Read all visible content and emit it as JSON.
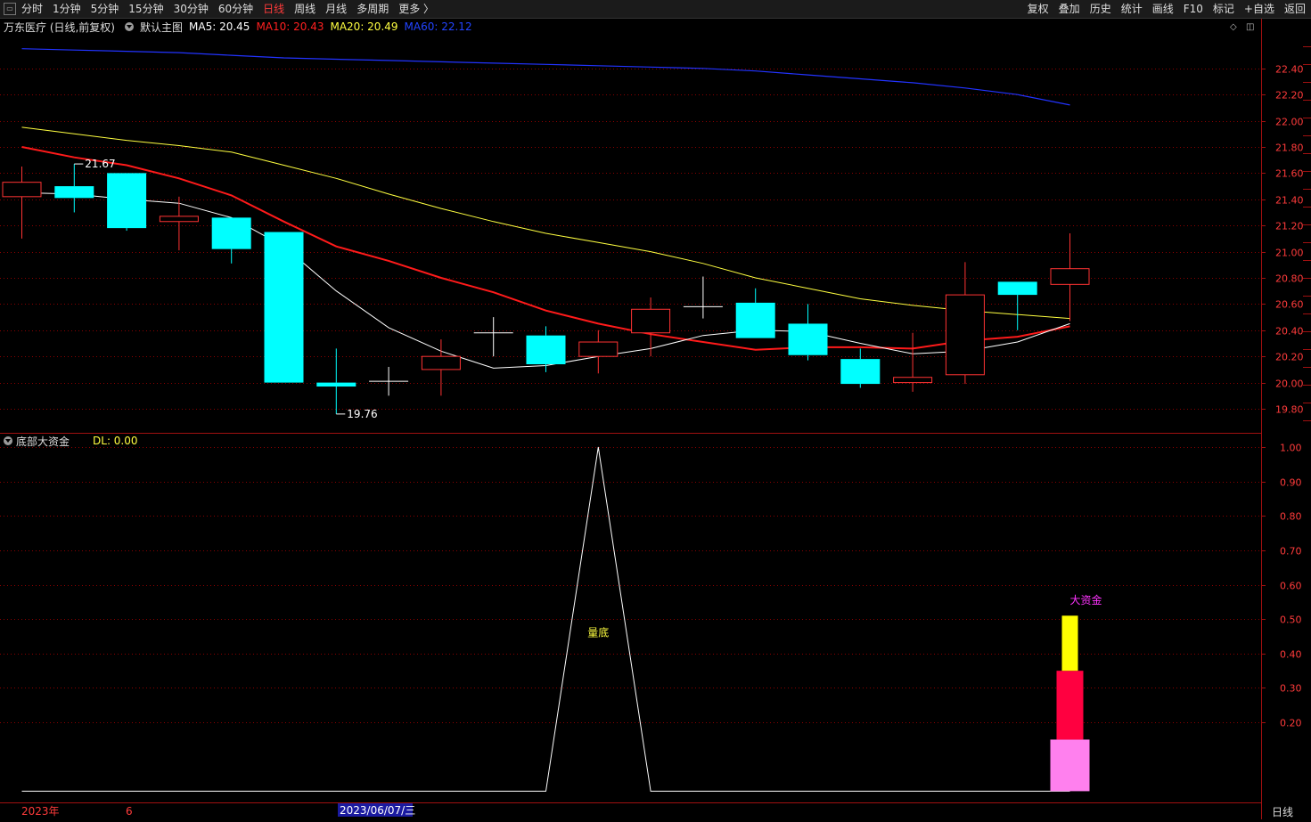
{
  "toolbar": {
    "tabs": [
      "分时",
      "1分钟",
      "5分钟",
      "15分钟",
      "30分钟",
      "60分钟",
      "日线",
      "周线",
      "月线",
      "多周期",
      "更多 〉"
    ],
    "active_tab": "日线",
    "right_tools": [
      "复权",
      "叠加",
      "历史",
      "统计",
      "画线",
      "F10",
      "标记",
      "+自选",
      "返回"
    ]
  },
  "main_chart": {
    "title": "万东医疗 (日线,前复权)",
    "indicator": "默认主图",
    "ma": [
      {
        "label": "MA5: 20.45",
        "color": "#ffffff"
      },
      {
        "label": "MA10: 20.43",
        "color": "#ff2020"
      },
      {
        "label": "MA20: 20.49",
        "color": "#ffff40"
      },
      {
        "label": "MA60: 22.12",
        "color": "#2244ff"
      }
    ],
    "high_marker": "21.67",
    "low_marker": "19.76"
  },
  "sub_chart": {
    "title": "底部大资金",
    "dl_label": "DL: 0.00",
    "peak_label": "量底",
    "bar_label": "大资金"
  },
  "footer": {
    "year_label": "2023年",
    "month_label": "6",
    "date_label": "2023/06/07/三",
    "period_label": "日线"
  },
  "colors": {
    "up": "#ff3333",
    "down": "#00ffff",
    "ma5": "#ffffff",
    "ma10": "#ff1a1a",
    "ma20": "#ffff40",
    "ma60": "#2233ff",
    "grid": "#8b0000"
  },
  "chart_data": {
    "type": "candlestick",
    "y_axis": {
      "ticks": [
        "22.40",
        "22.20",
        "22.00",
        "21.80",
        "21.60",
        "21.40",
        "21.20",
        "21.00",
        "20.80",
        "20.60",
        "20.40",
        "20.20",
        "20.00",
        "19.80"
      ],
      "range": [
        19.63,
        22.65
      ]
    },
    "candles": [
      {
        "o": 21.42,
        "h": 21.65,
        "l": 21.1,
        "c": 21.53
      },
      {
        "o": 21.5,
        "h": 21.67,
        "l": 21.3,
        "c": 21.41
      },
      {
        "o": 21.6,
        "h": 21.6,
        "l": 21.16,
        "c": 21.18
      },
      {
        "o": 21.23,
        "h": 21.42,
        "l": 21.01,
        "c": 21.27
      },
      {
        "o": 21.26,
        "h": 21.26,
        "l": 20.91,
        "c": 21.02
      },
      {
        "o": 21.15,
        "h": 21.15,
        "l": 20.0,
        "c": 20.0
      },
      {
        "o": 20.0,
        "h": 20.26,
        "l": 19.76,
        "c": 19.97
      },
      {
        "o": 20.01,
        "h": 20.12,
        "l": 19.9,
        "c": 20.01
      },
      {
        "o": 20.1,
        "h": 20.33,
        "l": 19.9,
        "c": 20.2
      },
      {
        "o": 20.38,
        "h": 20.5,
        "l": 20.2,
        "c": 20.38
      },
      {
        "o": 20.36,
        "h": 20.43,
        "l": 20.08,
        "c": 20.14
      },
      {
        "o": 20.2,
        "h": 20.4,
        "l": 20.07,
        "c": 20.31
      },
      {
        "o": 20.38,
        "h": 20.65,
        "l": 20.2,
        "c": 20.56
      },
      {
        "o": 20.58,
        "h": 20.81,
        "l": 20.49,
        "c": 20.58
      },
      {
        "o": 20.61,
        "h": 20.72,
        "l": 20.34,
        "c": 20.34
      },
      {
        "o": 20.45,
        "h": 20.6,
        "l": 20.17,
        "c": 20.21
      },
      {
        "o": 20.18,
        "h": 20.26,
        "l": 19.96,
        "c": 19.99
      },
      {
        "o": 20.0,
        "h": 20.38,
        "l": 19.93,
        "c": 20.04
      },
      {
        "o": 20.06,
        "h": 20.92,
        "l": 19.99,
        "c": 20.67
      },
      {
        "o": 20.77,
        "h": 20.77,
        "l": 20.4,
        "c": 20.67
      },
      {
        "o": 20.75,
        "h": 21.14,
        "l": 20.47,
        "c": 20.87
      }
    ],
    "ma5": [
      21.45,
      21.44,
      21.4,
      21.37,
      21.26,
      21.04,
      20.7,
      20.42,
      20.24,
      20.11,
      20.13,
      20.2,
      20.26,
      20.36,
      20.4,
      20.39,
      20.3,
      20.22,
      20.24,
      20.31,
      20.45
    ],
    "ma10": [
      21.8,
      21.72,
      21.66,
      21.56,
      21.43,
      21.23,
      21.04,
      20.93,
      20.8,
      20.69,
      20.55,
      20.45,
      20.37,
      20.31,
      20.25,
      20.27,
      20.27,
      20.26,
      20.32,
      20.35,
      20.43
    ],
    "ma20": [
      21.95,
      21.9,
      21.85,
      21.81,
      21.76,
      21.66,
      21.56,
      21.44,
      21.33,
      21.23,
      21.14,
      21.07,
      21.0,
      20.91,
      20.8,
      20.72,
      20.64,
      20.59,
      20.55,
      20.52,
      20.49
    ],
    "ma60": [
      22.55,
      22.54,
      22.53,
      22.52,
      22.5,
      22.48,
      22.47,
      22.46,
      22.45,
      22.44,
      22.43,
      22.42,
      22.41,
      22.4,
      22.38,
      22.35,
      22.32,
      22.29,
      22.25,
      22.2,
      22.12
    ],
    "sub": {
      "y_ticks": [
        "1.00",
        "0.90",
        "0.80",
        "0.70",
        "0.60",
        "0.50",
        "0.40",
        "0.30",
        "0.20"
      ],
      "range": [
        -0.03,
        1.0
      ],
      "dl_line": [
        0,
        0,
        0,
        0,
        0,
        0,
        0,
        0,
        0,
        0,
        0,
        1,
        0,
        0,
        0,
        0,
        0,
        0,
        0,
        0,
        0
      ],
      "bar_segments": [
        {
          "from": 0.0,
          "to": 0.15,
          "color": "#ff80ee"
        },
        {
          "from": 0.15,
          "to": 0.35,
          "color": "#ff0040"
        },
        {
          "from": 0.35,
          "to": 0.51,
          "color": "#ffff00"
        }
      ]
    }
  }
}
